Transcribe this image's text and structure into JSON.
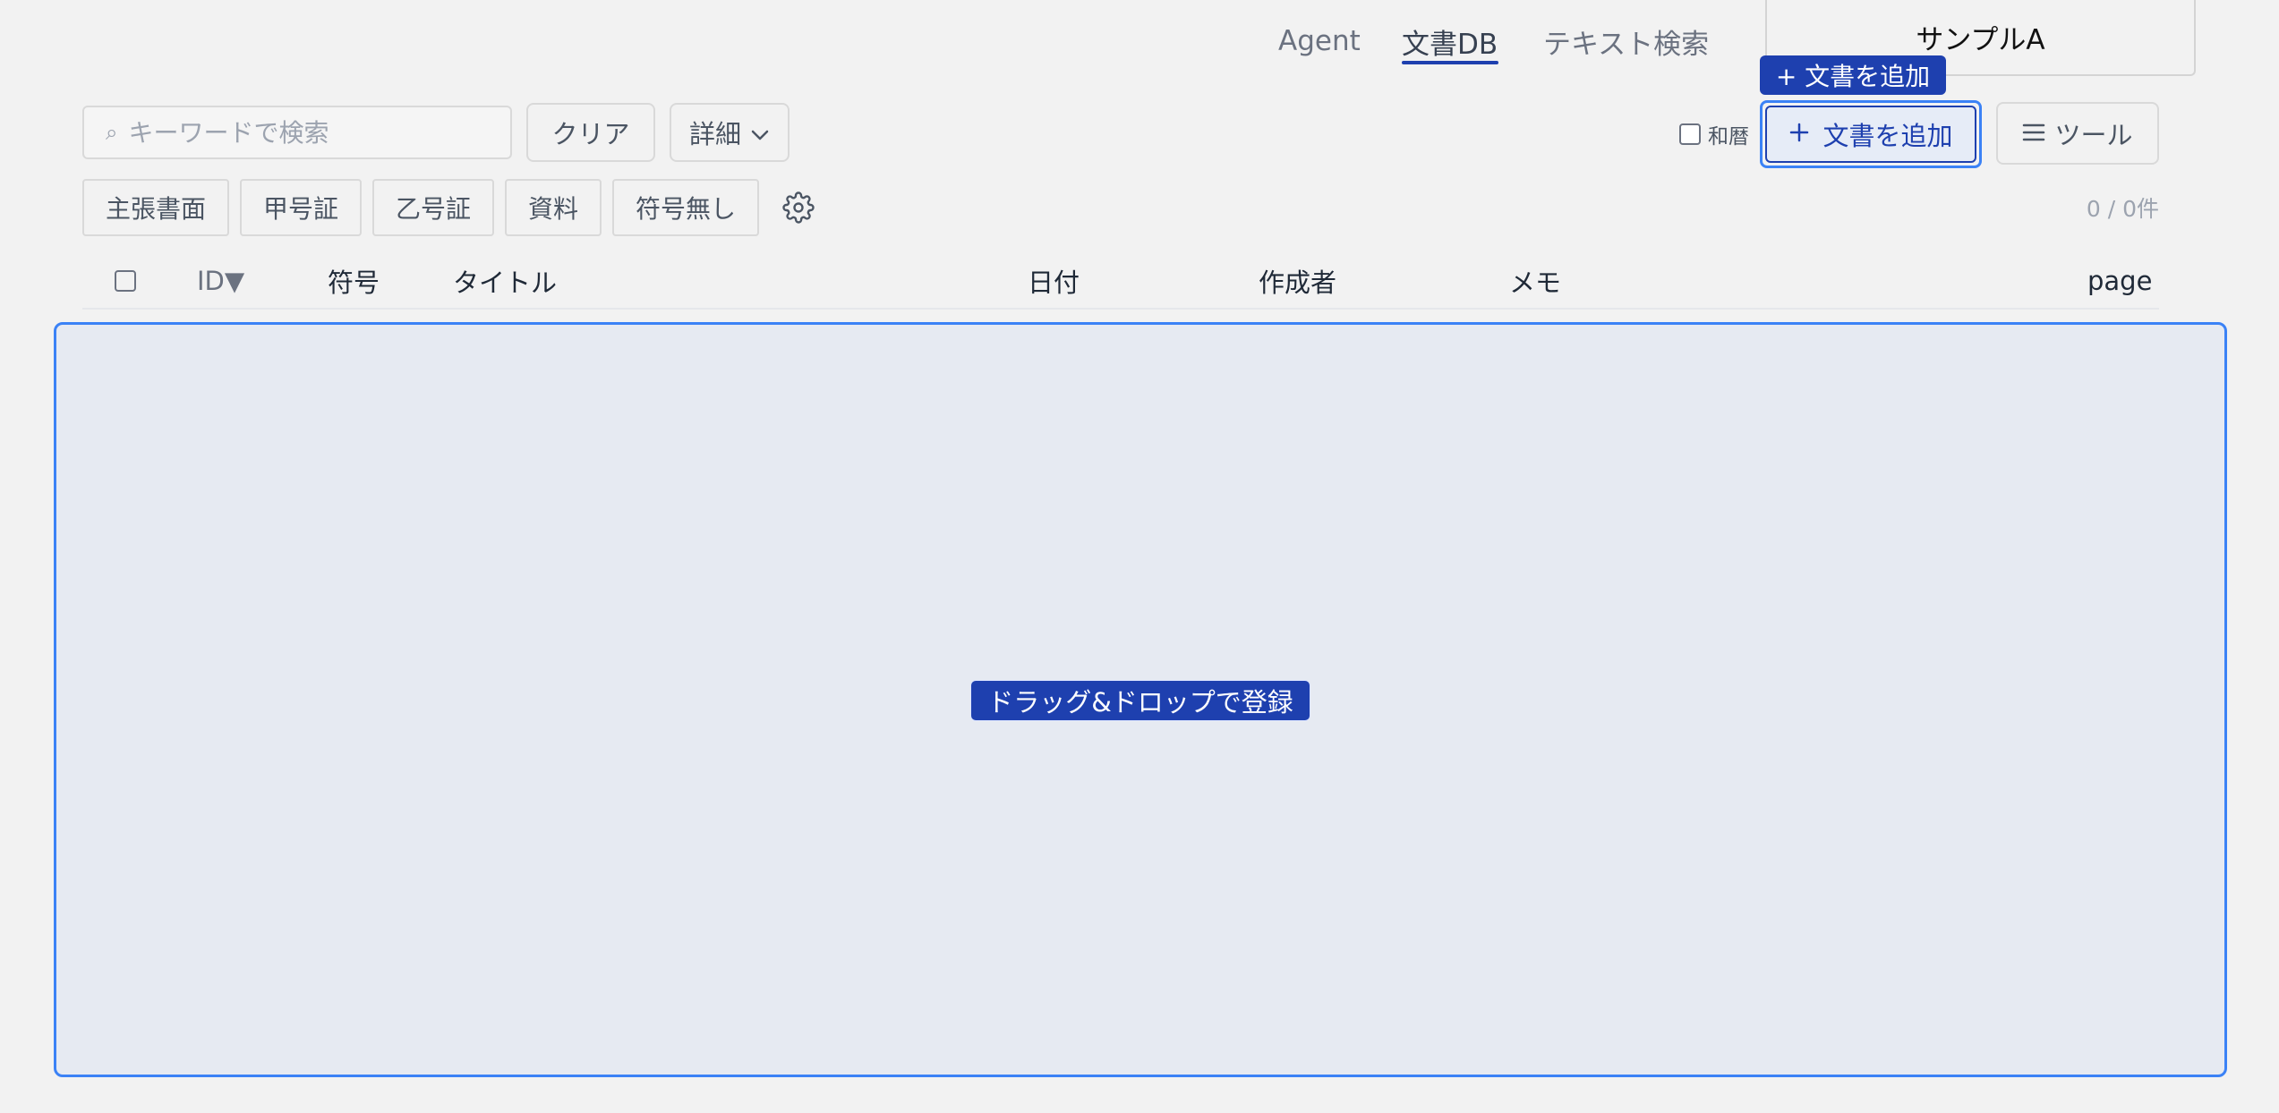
{
  "nav": {
    "tabs": [
      {
        "label": "Agent"
      },
      {
        "label": "文書DB"
      },
      {
        "label": "テキスト検索"
      }
    ],
    "project": "サンプルA"
  },
  "tooltip": "+ 文書を追加",
  "toolbar": {
    "search_placeholder": "キーワードで検索",
    "search_icon": "⌕",
    "clear_label": "クリア",
    "detail_label": "詳細",
    "wareki_label": "和暦",
    "add_label": "文書を追加",
    "tools_label": "ツール"
  },
  "filters": [
    "主張書面",
    "甲号証",
    "乙号証",
    "資料",
    "符号無し"
  ],
  "count": "0 / 0件",
  "table": {
    "columns": {
      "id": "ID▼",
      "code": "符号",
      "title": "タイトル",
      "date": "日付",
      "author": "作成者",
      "memo": "メモ",
      "page": "page"
    }
  },
  "dropzone": {
    "label": "ドラッグ&ドロップで登録"
  },
  "colors": {
    "accent": "#1e40af",
    "focus": "#3b82f6",
    "background": "#f2f2f2",
    "dropzone_bg": "#e6eaf2"
  }
}
